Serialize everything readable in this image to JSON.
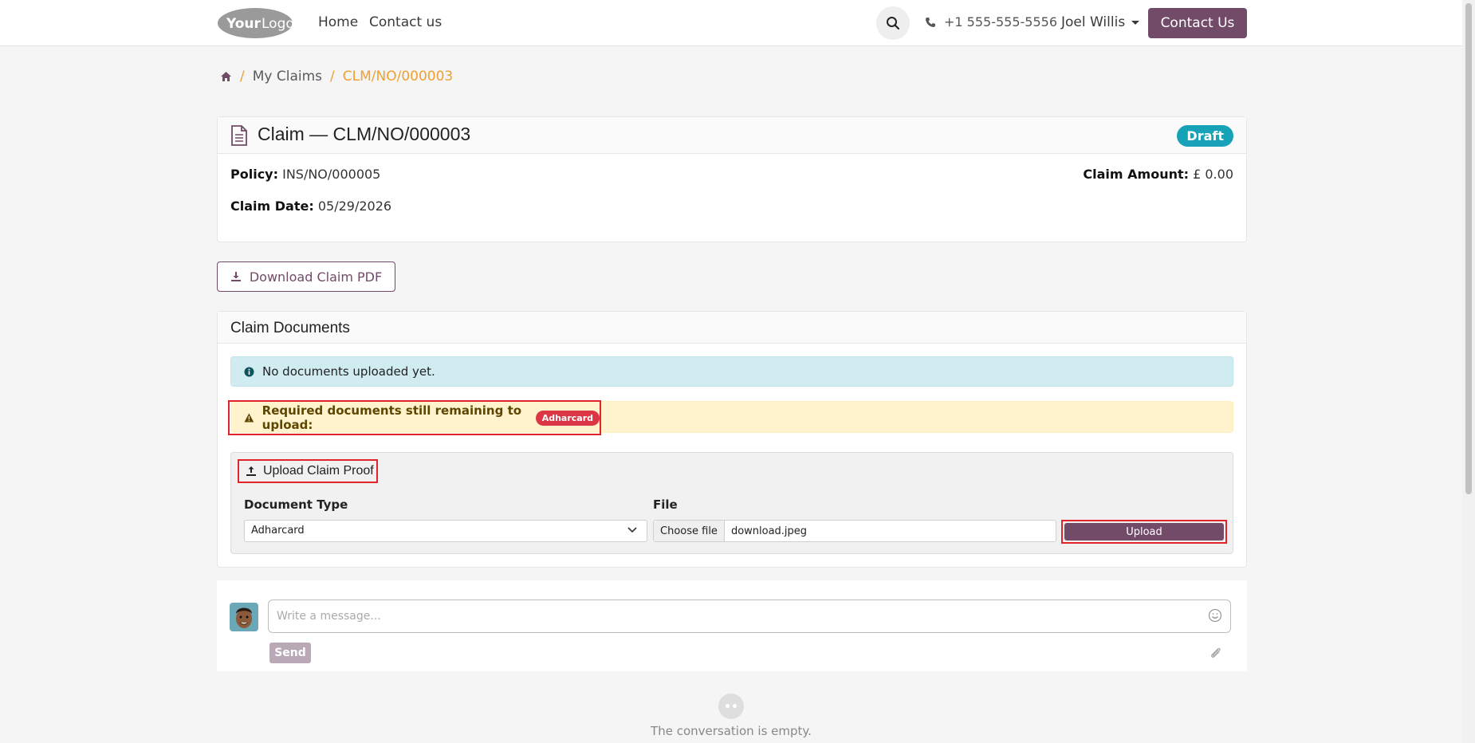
{
  "header": {
    "logo_alt": "YourLogo",
    "nav": [
      "Home",
      "Contact us"
    ],
    "phone": "+1 555-555-5556",
    "user": "Joel Willis",
    "contact_btn": "Contact Us"
  },
  "breadcrumb": {
    "items": [
      "My Claims",
      "CLM/NO/000003"
    ]
  },
  "claim": {
    "title": "Claim — CLM/NO/000003",
    "status": "Draft",
    "policy_label": "Policy:",
    "policy_value": "INS/NO/000005",
    "amount_label": "Claim Amount:",
    "amount_value": "£ 0.00",
    "date_label": "Claim Date:",
    "date_value": "05/29/2026"
  },
  "download_btn": "Download Claim PDF",
  "documents": {
    "title": "Claim Documents",
    "info": "No documents uploaded yet.",
    "warning": "Required documents still remaining to upload:",
    "remaining_badge": "Adharcard",
    "upload_title": "Upload Claim Proof",
    "doc_type_label": "Document Type",
    "doc_type_value": "Adharcard",
    "file_label": "File",
    "choose_file": "Choose file",
    "file_name": "download.jpeg",
    "upload_btn": "Upload"
  },
  "chatter": {
    "placeholder": "Write a message...",
    "send": "Send",
    "empty": "The conversation is empty."
  },
  "colors": {
    "brand": "#714b67",
    "accent": "#f0a030",
    "draft": "#17a2b8",
    "danger": "#dc3545"
  },
  "icons": [
    "home-icon",
    "search-icon",
    "phone-icon",
    "document-icon",
    "download-icon",
    "info-icon",
    "warning-icon",
    "upload-icon",
    "chevron-down-icon",
    "emoji-icon",
    "paperclip-icon"
  ]
}
